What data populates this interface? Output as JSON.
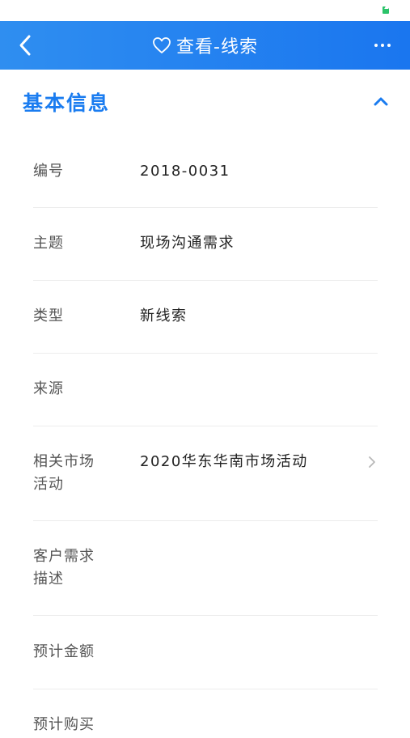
{
  "nav": {
    "title": "查看-线索"
  },
  "section": {
    "title": "基本信息"
  },
  "fields": [
    {
      "label": "编号",
      "value": "2018-0031"
    },
    {
      "label": "主题",
      "value": "现场沟通需求"
    },
    {
      "label": "类型",
      "value": "新线索"
    },
    {
      "label": "来源",
      "value": ""
    },
    {
      "label_line1": "相关市场",
      "label_line2": "活动",
      "value": "2020华东华南市场活动"
    },
    {
      "label_line1": "客户需求",
      "label_line2": "描述",
      "value": ""
    },
    {
      "label": "预计金额",
      "value": ""
    },
    {
      "label": "预计购买"
    }
  ],
  "colors": {
    "accent": "#1a7cf0",
    "nav_bg": "#2a86f0",
    "status_battery": "#2bc36a"
  },
  "icons": [
    "battery-icon",
    "back-icon",
    "heart-icon",
    "more-icon",
    "chevron-up-icon",
    "chevron-right-icon"
  ]
}
